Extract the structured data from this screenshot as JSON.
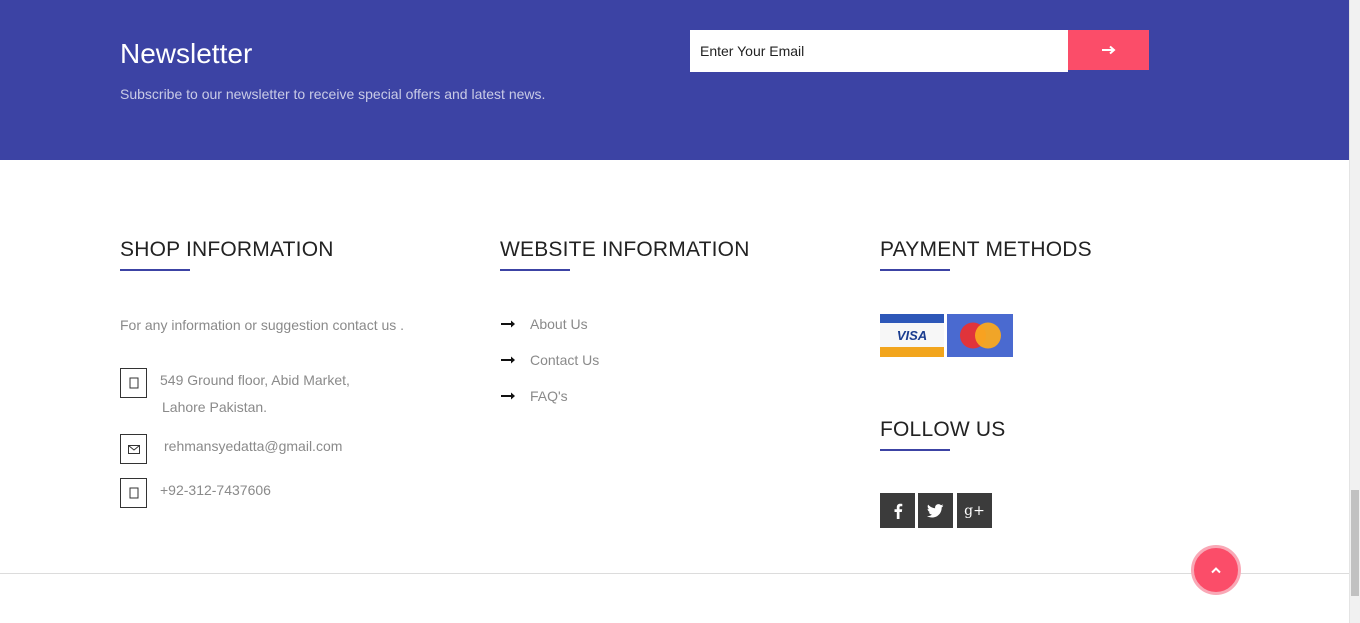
{
  "newsletter": {
    "title": "Newsletter",
    "subtitle": "Subscribe to our newsletter to receive special offers and latest news.",
    "email_placeholder": "Enter Your Email",
    "submit_icon": "arrow-right-icon"
  },
  "shop_info": {
    "heading": "SHOP INFORMATION",
    "intro": "For any information or suggestion contact us .",
    "address_line1": "549 Ground floor, Abid Market,",
    "address_line2": "Lahore Pakistan.",
    "email": "rehmansyedatta@gmail.com",
    "phone": "+92-312-7437606",
    "icons": [
      "map-marker-icon",
      "envelope-icon",
      "phone-icon"
    ]
  },
  "website_info": {
    "heading": "WEBSITE INFORMATION",
    "links": [
      {
        "label": "About Us",
        "icon": "arrow-right-icon"
      },
      {
        "label": "Contact Us",
        "icon": "arrow-right-icon"
      },
      {
        "label": "FAQ's",
        "icon": "arrow-right-icon"
      }
    ]
  },
  "payment": {
    "heading": "PAYMENT METHODS",
    "cards": [
      {
        "name": "VISA",
        "icon": "visa-card-icon"
      },
      {
        "name": "MasterCard",
        "icon": "mastercard-icon"
      }
    ]
  },
  "follow": {
    "heading": "FOLLOW US",
    "networks": [
      "facebook-icon",
      "twitter-icon",
      "google-plus-icon"
    ],
    "google_plus_label": "g+"
  },
  "colors": {
    "primary": "#3c43a4",
    "accent": "#fb4d69",
    "muted_text": "#8a8a8a",
    "social_bg": "#3b3b3b"
  },
  "back_to_top_icon": "chevron-up-icon"
}
